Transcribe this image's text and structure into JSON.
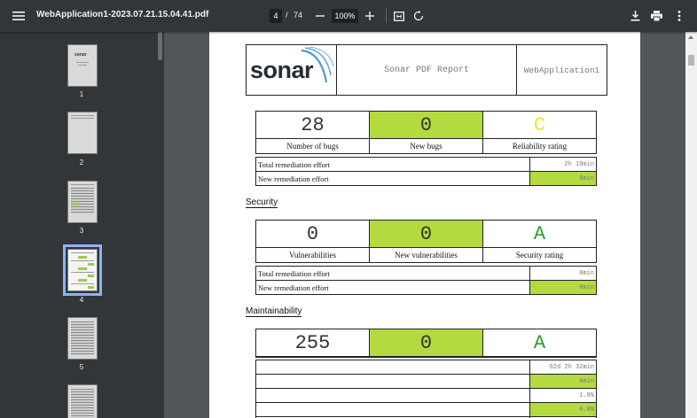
{
  "toolbar": {
    "filename": "WebApplication1-2023.07.21.15.04.41.pdf",
    "current_page": "4",
    "page_separator": "/",
    "total_pages": "74",
    "zoom": "100%"
  },
  "thumbnails": [
    {
      "label": "1"
    },
    {
      "label": "2"
    },
    {
      "label": "3"
    },
    {
      "label": "4"
    },
    {
      "label": "5"
    }
  ],
  "thumb1_brand": "sonar",
  "report": {
    "logo_text": "sonar",
    "title": "Sonar PDF Report",
    "app_name": "WebApplication1"
  },
  "reliability": {
    "bugs": "28",
    "bugs_label": "Number of bugs",
    "new_bugs": "0",
    "new_bugs_label": "New bugs",
    "rating": "C",
    "rating_label": "Reliability rating",
    "rating_color": "#f2e22a",
    "total_effort_label": "Total remediation effort",
    "total_effort": "2h 10min",
    "new_effort_label": "New remediation effort",
    "new_effort": "0min"
  },
  "security": {
    "heading": "Security",
    "vulns": "0",
    "vulns_label": "Vulnerabilities",
    "new_vulns": "0",
    "new_vulns_label": "New vulnerabilities",
    "rating": "A",
    "rating_label": "Security rating",
    "rating_color": "#2aa02a",
    "total_effort_label": "Total remediation effort",
    "total_effort": "0min",
    "new_effort_label": "New remediation effort",
    "new_effort": "0min"
  },
  "maintainability": {
    "heading": "Maintainability",
    "smells": "255",
    "new_smells": "0",
    "rating": "A",
    "rating_color": "#2aa02a",
    "rows": [
      "62d 2h 32min",
      "0min",
      "1.8%",
      "0.0%"
    ]
  },
  "colors": {
    "accent_green": "#b3db3f",
    "toolbar_bg": "#323639",
    "viewer_bg": "#525659",
    "selected_thumb": "#8ab4f8"
  }
}
